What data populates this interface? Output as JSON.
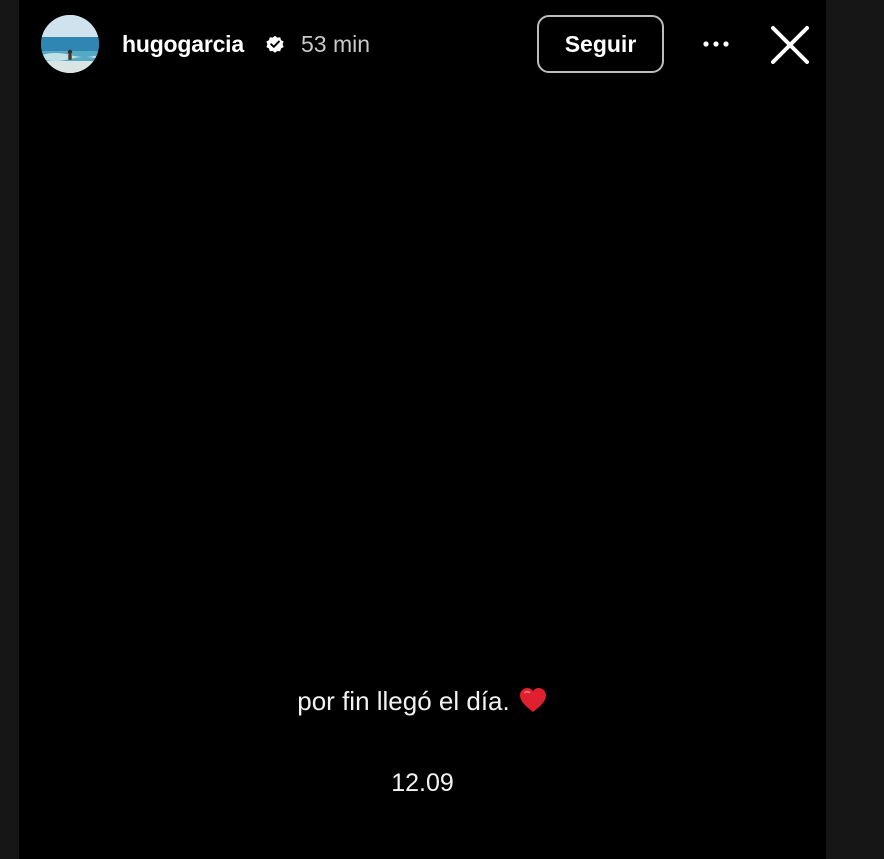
{
  "header": {
    "username": "hugogarcia",
    "time_ago": "53 min",
    "follow_label": "Seguir",
    "verified_icon": "verified-badge-icon",
    "more_icon": "more-options-icon",
    "close_icon": "close-icon"
  },
  "story": {
    "caption": "por fin llegó el día.",
    "caption_emoji": "heart-emoji-icon",
    "date": "12.09"
  },
  "colors": {
    "background": "#000000",
    "text": "#ffffff",
    "muted_text": "#c9c9c9",
    "heart": "#e0202e"
  }
}
